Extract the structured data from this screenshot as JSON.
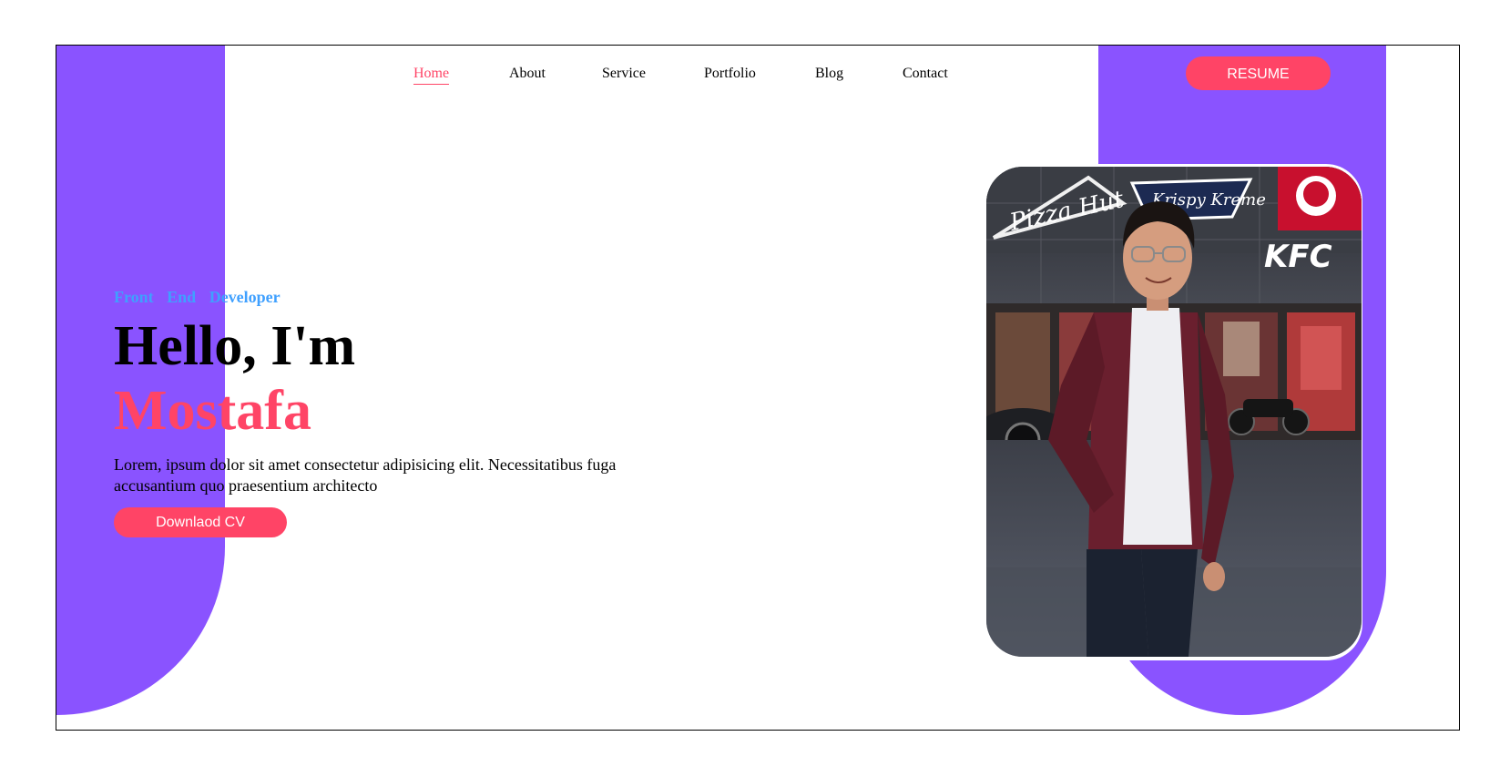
{
  "nav": {
    "links": [
      {
        "label": "Home",
        "active": true
      },
      {
        "label": "About",
        "active": false
      },
      {
        "label": "Service",
        "active": false
      },
      {
        "label": "Portfolio",
        "active": false
      },
      {
        "label": "Blog",
        "active": false
      },
      {
        "label": "Contact",
        "active": false
      }
    ],
    "resume_label": "RESUME"
  },
  "hero": {
    "role": "Front End Developer",
    "greeting": "Hello, I'm",
    "name": "Mostafa",
    "description": "Lorem, ipsum dolor sit amet consectetur adipisicing elit. Necessitatibus fuga accusantium quo praesentium architecto",
    "cv_label": "Downlaod CV"
  },
  "photo": {
    "signs": [
      "Pizza Hut",
      "Krispy Kreme",
      "KFC"
    ]
  },
  "colors": {
    "accent": "#ff4466",
    "purple": "#8a53ff",
    "role": "#3fa0ff"
  }
}
